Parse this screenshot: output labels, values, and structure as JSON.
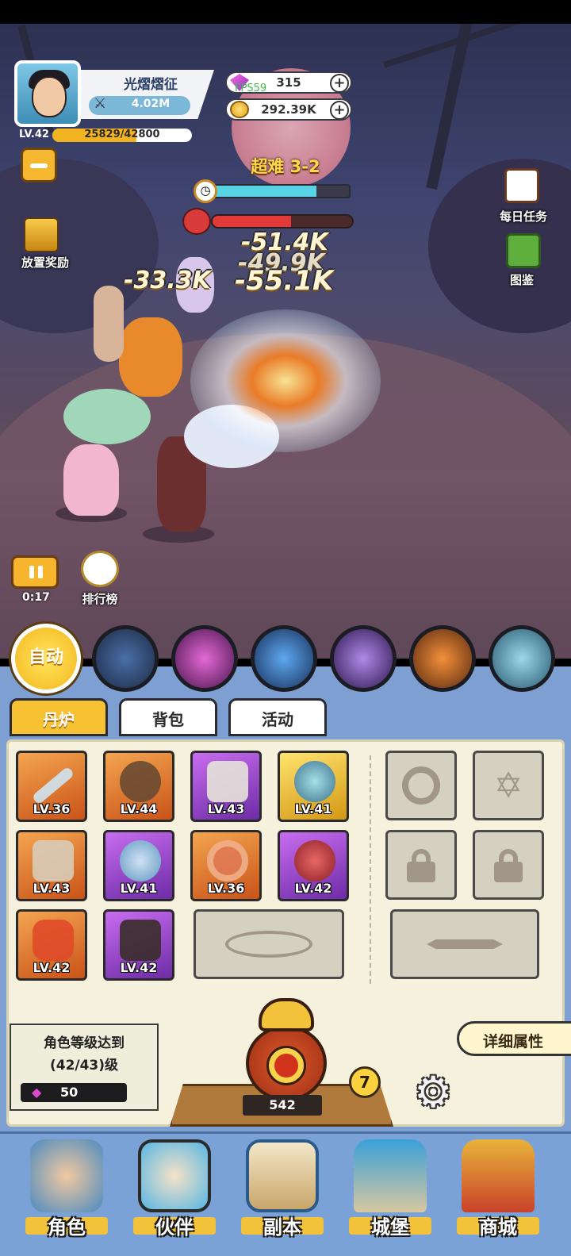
{
  "player": {
    "name": "光熠熠征",
    "power": "4.02M",
    "level": "LV.42",
    "exp_text": "25829/42800",
    "exp_fraction": 0.6
  },
  "currency": {
    "gems": "315",
    "coins": "292.39K",
    "fps": "FPS59"
  },
  "battle": {
    "stage": "超难 3-2",
    "timer_fraction": 0.76,
    "enemy_hp_fraction": 0.56,
    "damage_numbers": [
      "-51.4K",
      "-49.9K",
      "-33.3K",
      "-55.1K"
    ],
    "elapsed": "0:17"
  },
  "side_buttons": {
    "idle_reward": "放置奖励",
    "daily_task": "每日任务",
    "codex": "图鉴",
    "ranking": "排行榜"
  },
  "skills": {
    "auto_label": "自动",
    "icons": [
      "lightning-skill-icon",
      "vortex-skill-icon",
      "comet-skill-icon",
      "shuriken-skill-icon",
      "strongman-skill-icon",
      "beast-skill-icon"
    ]
  },
  "tabs": [
    "丹炉",
    "背包",
    "活动"
  ],
  "equipment": [
    {
      "lv": "LV.36",
      "rarity": "orange"
    },
    {
      "lv": "LV.44",
      "rarity": "orange"
    },
    {
      "lv": "LV.43",
      "rarity": "purple"
    },
    {
      "lv": "LV.41",
      "rarity": "gold"
    },
    {
      "lv": "LV.43",
      "rarity": "orange"
    },
    {
      "lv": "LV.41",
      "rarity": "purple"
    },
    {
      "lv": "LV.36",
      "rarity": "orange"
    },
    {
      "lv": "LV.42",
      "rarity": "purple"
    },
    {
      "lv": "LV.42",
      "rarity": "orange"
    },
    {
      "lv": "LV.42",
      "rarity": "purple"
    }
  ],
  "quest": {
    "line1": "角色等级达到",
    "line2": "(42/43)级",
    "reward": "50"
  },
  "detail_button": "详细属性",
  "furnace": {
    "count": "542",
    "badge": "7"
  },
  "nav": [
    "角色",
    "伙伴",
    "副本",
    "城堡",
    "商城"
  ],
  "colors": {
    "panel": "#7e9fd1",
    "accent": "#f6c234"
  }
}
